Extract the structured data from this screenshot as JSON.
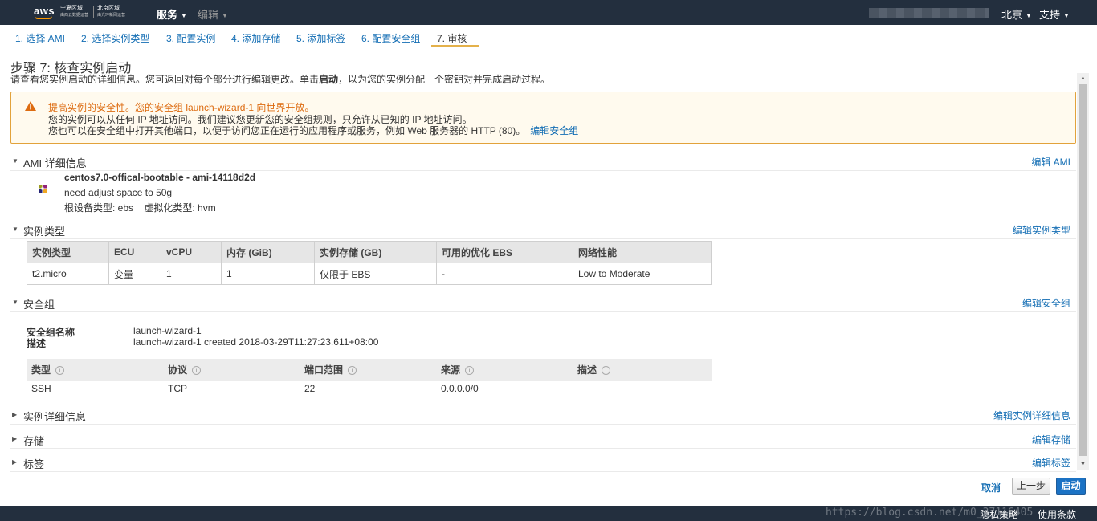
{
  "topbar": {
    "logo_text": "aws",
    "region1_title": "宁夏区域",
    "region1_sub": "由西云数据运营",
    "region2_title": "北京区域",
    "region2_sub": "由光环新网运营",
    "services_label": "服务",
    "edit_label": "编辑",
    "region_label": "北京",
    "support_label": "支持"
  },
  "wizard_tabs": [
    {
      "label": "1. 选择 AMI"
    },
    {
      "label": "2. 选择实例类型"
    },
    {
      "label": "3. 配置实例"
    },
    {
      "label": "4. 添加存储"
    },
    {
      "label": "5. 添加标签"
    },
    {
      "label": "6. 配置安全组"
    },
    {
      "label": "7. 审核"
    }
  ],
  "active_tab_index": 6,
  "page": {
    "title": "步骤 7: 核查实例启动",
    "desc_before": "请查看您实例启动的详细信息。您可返回对每个部分进行编辑更改。单击",
    "desc_bold": "启动",
    "desc_after": "，以为您的实例分配一个密钥对并完成启动过程。"
  },
  "warning": {
    "title": "提高实例的安全性。您的安全组 launch-wizard-1 向世界开放。",
    "line1": "您的实例可以从任何 IP 地址访问。我们建议您更新您的安全组规则，只允许从已知的 IP 地址访问。",
    "line2": "您也可以在安全组中打开其他端口，以便于访问您正在运行的应用程序或服务，例如 Web 服务器的 HTTP (80)。",
    "link": "编辑安全组",
    "color": "#dd6b10"
  },
  "sections": {
    "ami": {
      "title": "AMI 详细信息",
      "edit": "编辑 AMI"
    },
    "instance_type": {
      "title": "实例类型",
      "edit": "编辑实例类型"
    },
    "security_group": {
      "title": "安全组",
      "edit": "编辑安全组"
    },
    "instance_details": {
      "title": "实例详细信息",
      "edit": "编辑实例详细信息"
    },
    "storage": {
      "title": "存储",
      "edit": "编辑存储"
    },
    "tags": {
      "title": "标签",
      "edit": "编辑标签"
    }
  },
  "ami": {
    "name": "centos7.0-offical-bootable - ami-14118d2d",
    "description": "need adjust space to 50g",
    "meta": "根设备类型: ebs    虚拟化类型: hvm"
  },
  "instance_table": {
    "headers": [
      "实例类型",
      "ECU",
      "vCPU",
      "内存 (GiB)",
      "实例存储 (GB)",
      "可用的优化 EBS",
      "网络性能"
    ],
    "rows": [
      [
        "t2.micro",
        "变量",
        "1",
        "1",
        "仅限于 EBS",
        "-",
        "Low to Moderate"
      ]
    ]
  },
  "security_group": {
    "name_label": "安全组名称",
    "name_value": "launch-wizard-1",
    "desc_label": "描述",
    "desc_value": "launch-wizard-1 created 2018-03-29T11:27:23.611+08:00",
    "rules_headers": [
      "类型",
      "协议",
      "端口范围",
      "来源",
      "描述"
    ],
    "rules": [
      [
        "SSH",
        "TCP",
        "22",
        "0.0.0.0/0",
        ""
      ]
    ]
  },
  "footer": {
    "cancel": "取消",
    "previous": "上一步",
    "launch": "启动",
    "privacy": "隐私策略",
    "terms": "使用条款",
    "watermark": "https://blog.csdn.net/m0_37116405"
  },
  "colors": {
    "navbar": "#232f3e",
    "link": "#146eb4",
    "accent": "#ff9900",
    "primary_button": "#1b72c4"
  }
}
